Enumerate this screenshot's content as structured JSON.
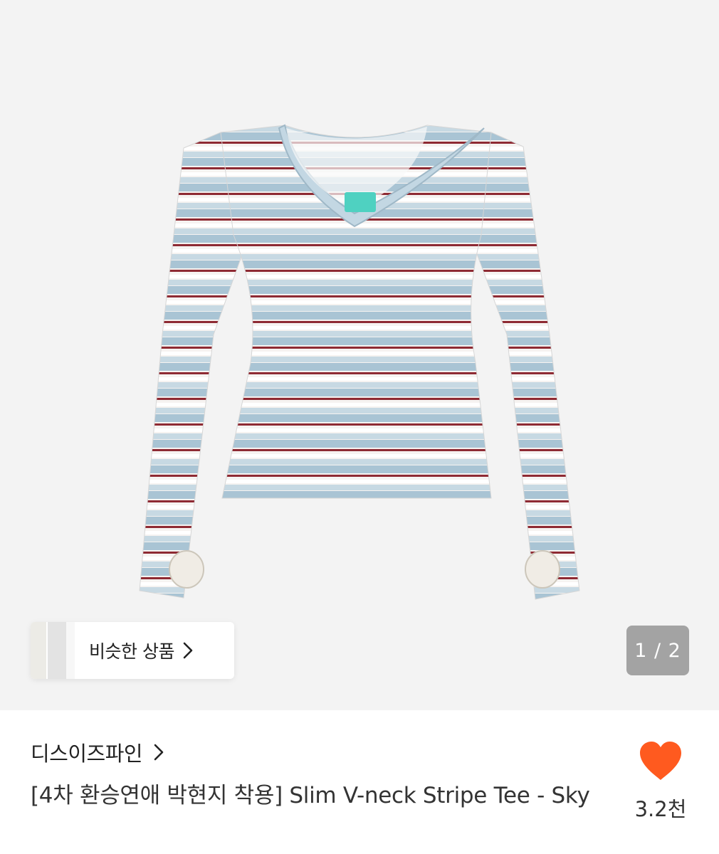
{
  "similar_products": {
    "label": "비슷한 상품",
    "chevron_icon": "chevron-right-icon"
  },
  "image_pager": {
    "text": "1 / 2",
    "current": 1,
    "total": 2
  },
  "seller": {
    "name": "디스이즈파인",
    "chevron_icon": "chevron-right-icon"
  },
  "product": {
    "title": "[4차 환승연애 박현지 착용] Slim V-neck Stripe Tee - Sky"
  },
  "like": {
    "icon": "heart-icon",
    "count": "3.2천",
    "color": "#ff5a1f"
  },
  "colors": {
    "hero_bg": "#f3f3f3",
    "stripe_blue": "#a9c4d4",
    "stripe_red": "#8e2a33",
    "stripe_white": "#f6f3f1",
    "label_mint": "#4fd1c1"
  }
}
